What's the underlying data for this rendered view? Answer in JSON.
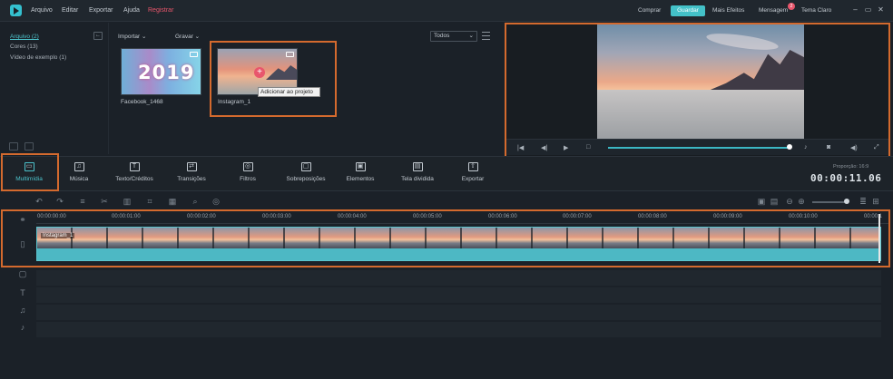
{
  "menu": {
    "items": [
      "Arquivo",
      "Editar",
      "Exportar",
      "Ajuda"
    ],
    "register": "Registrar"
  },
  "topbar": {
    "buy": "Comprar",
    "save": "Guardar",
    "more_effects": "Mais Efeitos",
    "messages": "Mensagem",
    "messages_badge": "2",
    "theme": "Tema Claro"
  },
  "sidebar": {
    "items": [
      {
        "label": "Arquivo (2)",
        "active": true
      },
      {
        "label": "Cores (13)",
        "active": false
      },
      {
        "label": "Vídeo de exemplo (1)",
        "active": false
      }
    ]
  },
  "media": {
    "import_label": "Importar",
    "record_label": "Gravar",
    "filter_value": "Todos",
    "thumbs": [
      {
        "label": "Facebook_1468",
        "text": "2019"
      },
      {
        "label": "Instagram_1",
        "tooltip": "Adicionar ao projeto"
      }
    ]
  },
  "tabs": [
    {
      "label": "Multimídia",
      "icon": "folder-icon",
      "glyph": "▭",
      "active": true
    },
    {
      "label": "Música",
      "icon": "music-icon",
      "glyph": "♫",
      "active": false
    },
    {
      "label": "Texto/Créditos",
      "icon": "text-icon",
      "glyph": "T",
      "active": false
    },
    {
      "label": "Transições",
      "icon": "transition-icon",
      "glyph": "⇄",
      "active": false
    },
    {
      "label": "Filtros",
      "icon": "filter-icon",
      "glyph": "◎",
      "active": false
    },
    {
      "label": "Sobreposições",
      "icon": "overlay-icon",
      "glyph": "▢",
      "active": false
    },
    {
      "label": "Elementos",
      "icon": "elements-icon",
      "glyph": "▣",
      "active": false
    },
    {
      "label": "Tela dividida",
      "icon": "split-screen-icon",
      "glyph": "▤",
      "active": false
    },
    {
      "label": "Exportar",
      "icon": "export-icon",
      "glyph": "⇧",
      "active": false
    }
  ],
  "project": {
    "label": "Proporção: 16:9",
    "time": "00:00:11.06"
  },
  "timeline": {
    "ticks": [
      "00:00:00:00",
      "00:00:01:00",
      "00:00:02:00",
      "00:00:03:00",
      "00:00:04:00",
      "00:00:05:00",
      "00:00:06:00",
      "00:00:07:00",
      "00:00:08:00",
      "00:00:09:00",
      "00:00:10:00",
      "00:00:1"
    ],
    "clip_label": "Instagram_1"
  },
  "colors": {
    "accent": "#43c1c8",
    "highlight": "#d46a2e",
    "badge": "#e8566c",
    "background": "#1b2128"
  }
}
